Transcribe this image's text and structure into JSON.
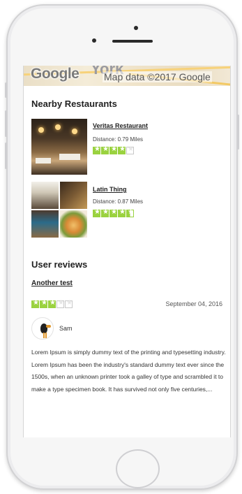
{
  "map": {
    "logo": "Google",
    "city_fragment": "York",
    "credit": "Map data ©2017 Google"
  },
  "nearby": {
    "title": "Nearby Restaurants",
    "restaurants": [
      {
        "name": "Veritas Restaurant",
        "distance": "Distance: 0.79 Miles",
        "rating": 4
      },
      {
        "name": "Latin Thing",
        "distance": "Distance: 0.87 Miles",
        "rating": 4.5
      }
    ]
  },
  "reviews": {
    "title": "User reviews",
    "items": [
      {
        "title": "Another test",
        "rating": 3,
        "date": "September 04, 2016",
        "author": "Sam",
        "body": "Lorem Ipsum is simply dummy text of the printing and typesetting industry. Lorem Ipsum has been the industry's standard dummy text ever since the 1500s, when an unknown printer took a galley of type and scrambled it to make a type specimen book. It has survived not only five centuries,..."
      }
    ]
  },
  "colors": {
    "star_on": "#9ad23f",
    "star_off": "#ffffff",
    "star_border": "#c8c8c8"
  },
  "icons": {
    "device_frame": "iphone-frame",
    "home_button": "home-button-icon",
    "avatar": "bird-avatar-icon",
    "rating_star": "star-icon"
  }
}
